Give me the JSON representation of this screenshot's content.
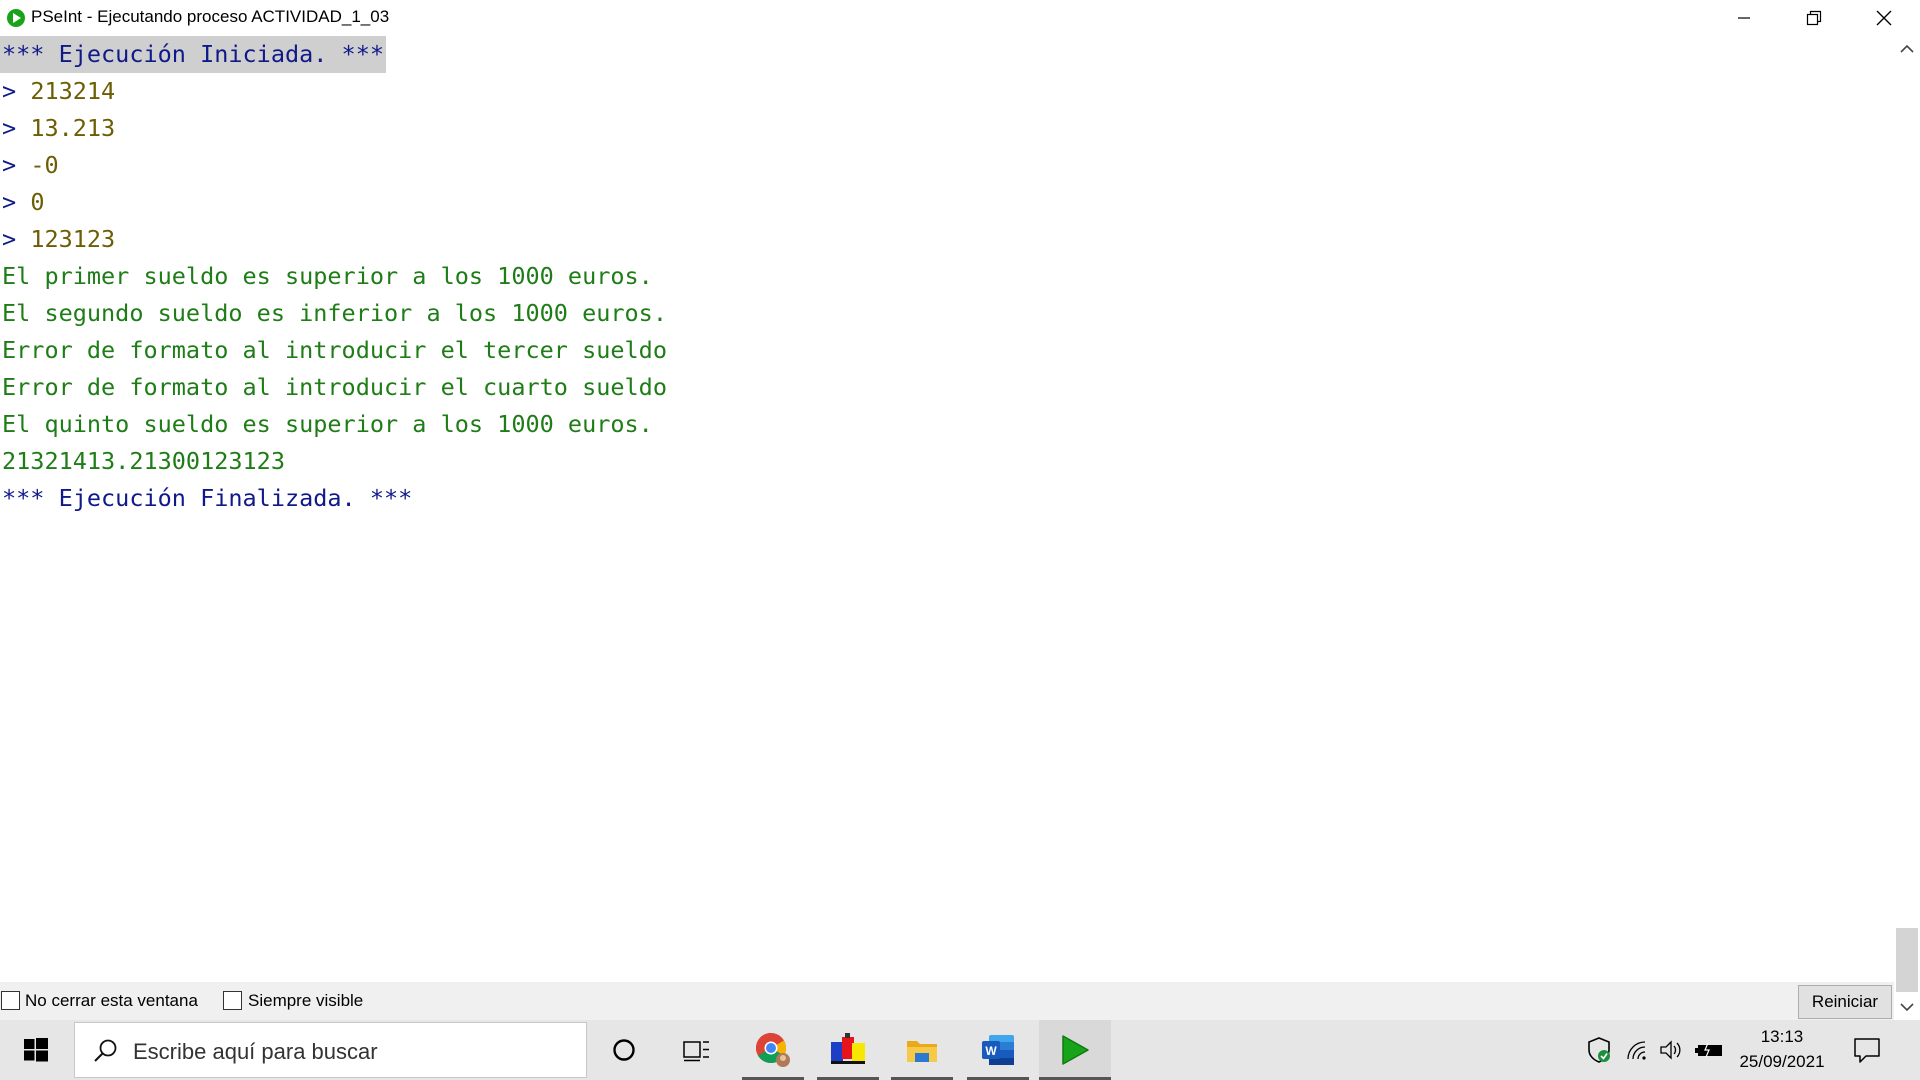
{
  "window": {
    "title": "PSeInt - Ejecutando proceso ACTIVIDAD_1_03",
    "app_icon": "pseint-play-icon",
    "controls": [
      "minimize-icon",
      "restore-icon",
      "close-icon"
    ]
  },
  "console": {
    "lines": [
      {
        "type": "system",
        "text": "*** Ejecución Iniciada. ***",
        "highlighted": true
      },
      {
        "type": "input",
        "prompt": ">",
        "text": "213214"
      },
      {
        "type": "input",
        "prompt": ">",
        "text": "13.213"
      },
      {
        "type": "input",
        "prompt": ">",
        "text": "-0"
      },
      {
        "type": "input",
        "prompt": ">",
        "text": "0"
      },
      {
        "type": "input",
        "prompt": ">",
        "text": "123123"
      },
      {
        "type": "output",
        "text": "El primer sueldo es superior a los 1000 euros."
      },
      {
        "type": "output",
        "text": "El segundo sueldo es inferior a los 1000 euros."
      },
      {
        "type": "output",
        "text": "Error de formato al introducir el tercer sueldo"
      },
      {
        "type": "output",
        "text": "Error de formato al introducir el cuarto sueldo"
      },
      {
        "type": "output",
        "text": "El quinto sueldo es superior a los 1000 euros."
      },
      {
        "type": "output",
        "text": "21321413.21300123123"
      },
      {
        "type": "system",
        "text": "*** Ejecución Finalizada. ***"
      }
    ],
    "colors": {
      "system": "#0f1a88",
      "input": "#6b5e05",
      "output": "#1f7d17"
    }
  },
  "options": {
    "no_cerrar_label": "No cerrar esta ventana",
    "no_cerrar_checked": false,
    "siempre_visible_label": "Siempre visible",
    "siempre_visible_checked": false,
    "reiniciar_label": "Reiniciar"
  },
  "taskbar": {
    "search_placeholder": "Escribe aquí para buscar",
    "items": [
      "cortana-icon",
      "task-view-icon",
      "chrome-icon",
      "app-icon",
      "file-explorer-icon",
      "word-icon",
      "pseint-icon"
    ],
    "tray": [
      "defender-icon",
      "wifi-icon",
      "volume-icon",
      "battery-icon"
    ],
    "time": "13:13",
    "date": "25/09/2021"
  }
}
